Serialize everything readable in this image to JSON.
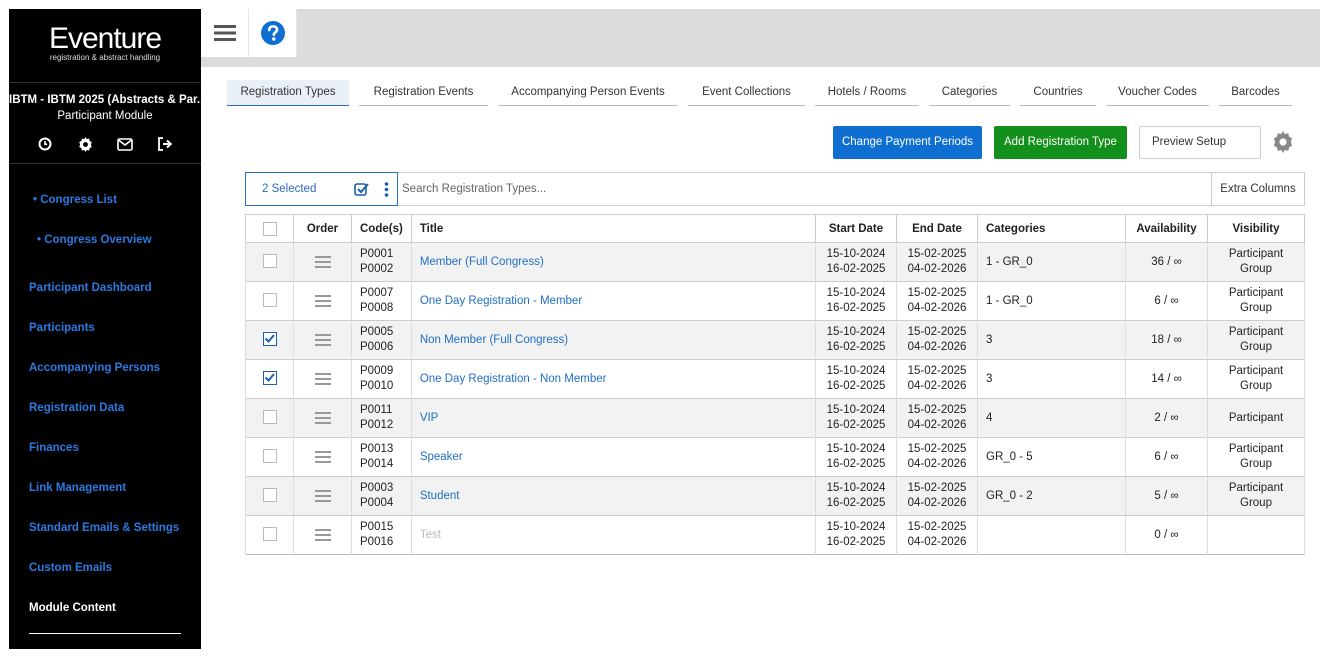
{
  "sidebar": {
    "logo_main": "Eventure",
    "logo_sub": "registration & abstract handling",
    "event_title": "IBTM - IBTM 2025 (Abstracts & Par...",
    "event_module": "Participant Module",
    "icons": [
      "clock-icon",
      "gear-icon",
      "mail-icon",
      "logout-icon"
    ],
    "sub_links": [
      "• Congress List",
      "• Congress Overview"
    ],
    "items": [
      "Participant Dashboard",
      "Participants",
      "Accompanying Persons",
      "Registration Data",
      "Finances",
      "Link Management",
      "Standard Emails & Settings",
      "Custom Emails",
      "Module Content"
    ],
    "active_item": "Module Content"
  },
  "topbar": {
    "icons": [
      "menu-icon",
      "help-icon"
    ]
  },
  "tabs": [
    "Registration Types",
    "Registration Events",
    "Accompanying Person Events",
    "Event Collections",
    "Hotels / Rooms",
    "Categories",
    "Countries",
    "Voucher Codes",
    "Barcodes"
  ],
  "active_tab": "Registration Types",
  "actions": {
    "change_payment": "Change Payment Periods",
    "add_type": "Add Registration Type",
    "preview": "Preview Setup"
  },
  "search": {
    "selected_label": "2 Selected",
    "placeholder": "Search Registration Types...",
    "extra_columns": "Extra Columns"
  },
  "table": {
    "headers": {
      "order": "Order",
      "codes": "Code(s)",
      "title": "Title",
      "start": "Start Date",
      "end": "End Date",
      "categories": "Categories",
      "availability": "Availability",
      "visibility": "Visibility"
    },
    "rows": [
      {
        "checked": false,
        "codes": [
          "P0001",
          "P0002"
        ],
        "title": "Member (Full Congress)",
        "start": [
          "15-10-2024",
          "16-02-2025"
        ],
        "end": [
          "15-02-2025",
          "04-02-2026"
        ],
        "categories": "1 - GR_0",
        "availability": "36 / ∞",
        "visibility": [
          "Participant",
          "Group"
        ],
        "muted": false
      },
      {
        "checked": false,
        "codes": [
          "P0007",
          "P0008"
        ],
        "title": "One Day Registration - Member",
        "start": [
          "15-10-2024",
          "16-02-2025"
        ],
        "end": [
          "15-02-2025",
          "04-02-2026"
        ],
        "categories": "1 - GR_0",
        "availability": "6 / ∞",
        "visibility": [
          "Participant",
          "Group"
        ],
        "muted": false
      },
      {
        "checked": true,
        "codes": [
          "P0005",
          "P0006"
        ],
        "title": "Non Member (Full Congress)",
        "start": [
          "15-10-2024",
          "16-02-2025"
        ],
        "end": [
          "15-02-2025",
          "04-02-2026"
        ],
        "categories": "3",
        "availability": "18 / ∞",
        "visibility": [
          "Participant",
          "Group"
        ],
        "muted": false
      },
      {
        "checked": true,
        "codes": [
          "P0009",
          "P0010"
        ],
        "title": "One Day Registration - Non Member",
        "start": [
          "15-10-2024",
          "16-02-2025"
        ],
        "end": [
          "15-02-2025",
          "04-02-2026"
        ],
        "categories": "3",
        "availability": "14 / ∞",
        "visibility": [
          "Participant",
          "Group"
        ],
        "muted": false
      },
      {
        "checked": false,
        "codes": [
          "P0011",
          "P0012"
        ],
        "title": "VIP",
        "start": [
          "15-10-2024",
          "16-02-2025"
        ],
        "end": [
          "15-02-2025",
          "04-02-2026"
        ],
        "categories": "4",
        "availability": "2 / ∞",
        "visibility": [
          "Participant"
        ],
        "muted": false
      },
      {
        "checked": false,
        "codes": [
          "P0013",
          "P0014"
        ],
        "title": "Speaker",
        "start": [
          "15-10-2024",
          "16-02-2025"
        ],
        "end": [
          "15-02-2025",
          "04-02-2026"
        ],
        "categories": "GR_0 - 5",
        "availability": "6 / ∞",
        "visibility": [
          "Participant",
          "Group"
        ],
        "muted": false
      },
      {
        "checked": false,
        "codes": [
          "P0003",
          "P0004"
        ],
        "title": "Student",
        "start": [
          "15-10-2024",
          "16-02-2025"
        ],
        "end": [
          "15-02-2025",
          "04-02-2026"
        ],
        "categories": "GR_0 - 2",
        "availability": "5 / ∞",
        "visibility": [
          "Participant",
          "Group"
        ],
        "muted": false
      },
      {
        "checked": false,
        "codes": [
          "P0015",
          "P0016"
        ],
        "title": "Test",
        "start": [
          "15-10-2024",
          "16-02-2025"
        ],
        "end": [
          "15-02-2025",
          "04-02-2026"
        ],
        "categories": "",
        "availability": "0 / ∞",
        "visibility": [],
        "muted": true
      }
    ]
  },
  "colors": {
    "sidebar_bg": "#000000",
    "link": "#2a7ae2",
    "primary_button": "#0e6fd1",
    "success_button": "#138f1b",
    "topbar_bg": "#dcdcdc"
  }
}
